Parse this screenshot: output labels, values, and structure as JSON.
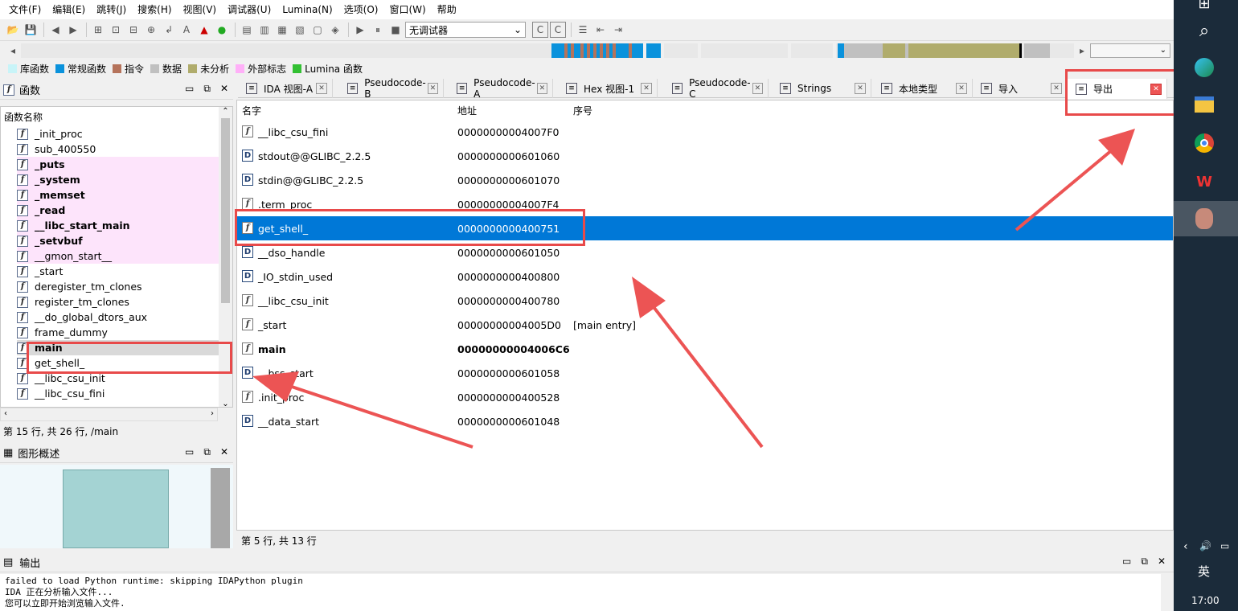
{
  "menu": [
    "文件(F)",
    "编辑(E)",
    "跳转(J)",
    "搜索(H)",
    "视图(V)",
    "调试器(U)",
    "Lumina(N)",
    "选项(O)",
    "窗口(W)",
    "帮助"
  ],
  "toolbar": {
    "debugger_select": "无调试器"
  },
  "legend": [
    {
      "label": "库函数",
      "color": "#c8f4f8"
    },
    {
      "label": "常规函数",
      "color": "#0a92dc"
    },
    {
      "label": "指令",
      "color": "#b5735b"
    },
    {
      "label": "数据",
      "color": "#c0c0c0"
    },
    {
      "label": "未分析",
      "color": "#b0ac6c"
    },
    {
      "label": "外部标志",
      "color": "#ffb0f8"
    },
    {
      "label": "Lumina 函数",
      "color": "#33c033"
    }
  ],
  "functions_panel": {
    "title": "函数",
    "column": "函数名称",
    "items": [
      {
        "name": "_init_proc",
        "style": "normal"
      },
      {
        "name": "sub_400550",
        "style": "normal"
      },
      {
        "name": "_puts",
        "style": "extern"
      },
      {
        "name": "_system",
        "style": "extern"
      },
      {
        "name": "_memset",
        "style": "extern"
      },
      {
        "name": "_read",
        "style": "extern"
      },
      {
        "name": "__libc_start_main",
        "style": "extern"
      },
      {
        "name": "_setvbuf",
        "style": "extern"
      },
      {
        "name": "__gmon_start__",
        "style": "externlight"
      },
      {
        "name": "_start",
        "style": "normal"
      },
      {
        "name": "deregister_tm_clones",
        "style": "normal"
      },
      {
        "name": "register_tm_clones",
        "style": "normal"
      },
      {
        "name": "__do_global_dtors_aux",
        "style": "normal"
      },
      {
        "name": "frame_dummy",
        "style": "normal"
      },
      {
        "name": "main",
        "style": "current"
      },
      {
        "name": "get_shell_",
        "style": "normal"
      },
      {
        "name": "__libc_csu_init",
        "style": "normal"
      },
      {
        "name": "__libc_csu_fini",
        "style": "normal"
      }
    ],
    "status": "第 15 行, 共 26 行, /main"
  },
  "graph_panel": {
    "title": "图形概述"
  },
  "tabs": [
    {
      "label": "IDA 视图-A",
      "icon": "ida-view-icon"
    },
    {
      "label": "Pseudocode-B",
      "icon": "pseudocode-icon"
    },
    {
      "label": "Pseudocode-A",
      "icon": "pseudocode-icon"
    },
    {
      "label": "Hex 视图-1",
      "icon": "hex-icon"
    },
    {
      "label": "Pseudocode-C",
      "icon": "pseudocode-icon"
    },
    {
      "label": "Strings",
      "icon": "strings-icon"
    },
    {
      "label": "本地类型",
      "icon": "local-types-icon"
    },
    {
      "label": "导入",
      "icon": "imports-icon"
    },
    {
      "label": "导出",
      "icon": "exports-icon"
    }
  ],
  "exports": {
    "columns": [
      "名字",
      "地址",
      "序号"
    ],
    "rows": [
      {
        "name": "__libc_csu_fini",
        "address": "00000000004007F0",
        "ordinal": "",
        "icon": "f"
      },
      {
        "name": "stdout@@GLIBC_2.2.5",
        "address": "0000000000601060",
        "ordinal": "",
        "icon": "D"
      },
      {
        "name": "stdin@@GLIBC_2.2.5",
        "address": "0000000000601070",
        "ordinal": "",
        "icon": "D"
      },
      {
        "name": ".term_proc",
        "address": "00000000004007F4",
        "ordinal": "",
        "icon": "f"
      },
      {
        "name": "get_shell_",
        "address": "0000000000400751",
        "ordinal": "",
        "icon": "f",
        "selected": true
      },
      {
        "name": "__dso_handle",
        "address": "0000000000601050",
        "ordinal": "",
        "icon": "D"
      },
      {
        "name": "_IO_stdin_used",
        "address": "0000000000400800",
        "ordinal": "",
        "icon": "D"
      },
      {
        "name": "__libc_csu_init",
        "address": "0000000000400780",
        "ordinal": "",
        "icon": "f"
      },
      {
        "name": "_start",
        "address": "00000000004005D0",
        "ordinal": "[main entry]",
        "icon": "f"
      },
      {
        "name": "main",
        "address": "00000000004006C6",
        "ordinal": "",
        "icon": "f",
        "bold": true
      },
      {
        "name": "__bss_start",
        "address": "0000000000601058",
        "ordinal": "",
        "icon": "D"
      },
      {
        "name": ".init_proc",
        "address": "0000000000400528",
        "ordinal": "",
        "icon": "f"
      },
      {
        "name": "__data_start",
        "address": "0000000000601048",
        "ordinal": "",
        "icon": "D"
      }
    ],
    "status": "第 5 行, 共 13 行"
  },
  "output": {
    "title": "输出",
    "lines": [
      "failed to load Python runtime: skipping IDAPython plugin",
      "IDA 正在分析输入文件...",
      "您可以立即开始浏览输入文件."
    ]
  },
  "taskbar": {
    "ime": "英",
    "time": "17:00"
  }
}
